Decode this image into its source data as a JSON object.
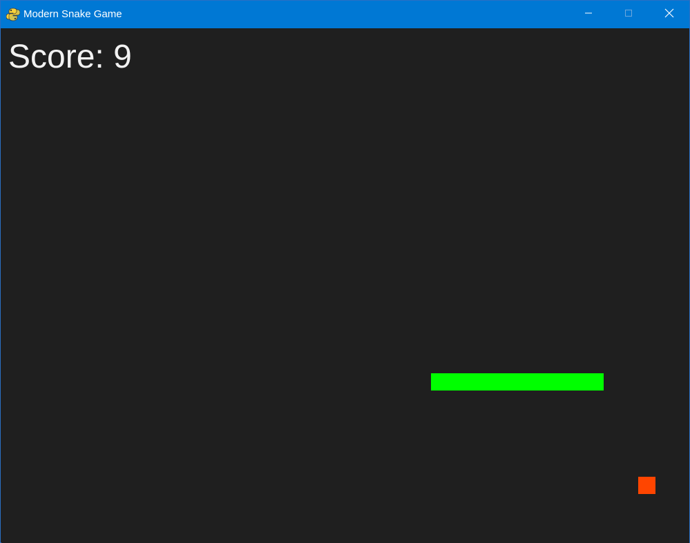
{
  "window": {
    "title": "Modern Snake Game",
    "app_icon": "pygame-snake-icon",
    "controls": {
      "minimize_icon": "minimize-icon",
      "maximize_icon": "maximize-icon",
      "close_icon": "close-icon"
    }
  },
  "hud": {
    "score_text": "Score: 9"
  },
  "game": {
    "grid_cell_units": 1,
    "snake_length": 10,
    "snake_cells": [
      [
        24,
        20
      ],
      [
        25,
        20
      ],
      [
        26,
        20
      ],
      [
        27,
        20
      ],
      [
        28,
        20
      ],
      [
        29,
        20
      ],
      [
        30,
        20
      ],
      [
        31,
        20
      ],
      [
        32,
        20
      ],
      [
        33,
        20
      ]
    ],
    "food_cell": [
      36,
      26
    ]
  },
  "colors": {
    "titlebar": "#0078d4",
    "background": "#1f1f1f",
    "snake": "#00ff00",
    "food": "#ff4500",
    "score_text": "#f2f2f2"
  }
}
